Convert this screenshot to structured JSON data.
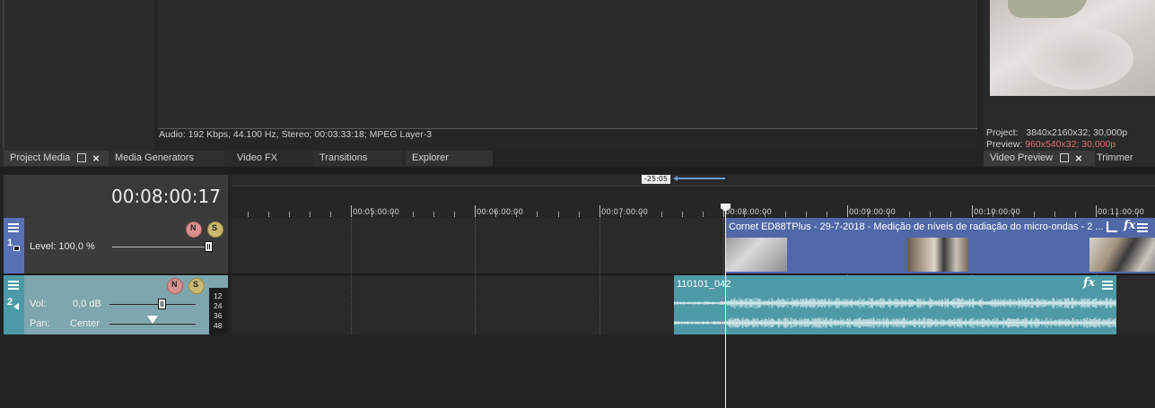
{
  "media_panel": {
    "info_text": "Audio: 192 Kbps, 44.100 Hz, Stereo; 00:03:33:18; MPEG Layer-3"
  },
  "left_tabs": [
    {
      "label": "Project Media"
    },
    {
      "label": "Media Generators"
    },
    {
      "label": "Video FX"
    },
    {
      "label": "Transitions"
    },
    {
      "label": "Explorer"
    }
  ],
  "preview": {
    "project_label": "Project:",
    "project_value": "3840x2160x32; 30,000p",
    "preview_label": "Preview:",
    "preview_value": "960x540x32; 30,000p",
    "preview_value_color": "#e07070"
  },
  "right_tabs": [
    {
      "label": "Video Preview"
    },
    {
      "label": "Trimmer"
    }
  ],
  "timeline": {
    "timecode": "00:08:00:17",
    "marker_label": "-25:05",
    "ruler_labels": [
      "00:05:00:00",
      "00:06:00:00",
      "00:07:00:00",
      "00:08:00:00",
      "00:09:00:00",
      "00:10:00:00",
      "00:11:00:00"
    ]
  },
  "tracks": {
    "video": {
      "number": "1",
      "level_label": "Level: 100,0 %",
      "level_value": 1.0,
      "clip_title": "Cornet ED88TPlus - 29-7-2018 - Medição de níveis de radiação do micro-ondas - 2 ...",
      "clip_color": "#5068a8"
    },
    "audio": {
      "number": "2",
      "vol_label": "Vol:",
      "vol_value": "0,0 dB",
      "pan_label": "Pan:",
      "pan_value": "Center",
      "meter_labels": [
        "12",
        "24",
        "36",
        "48"
      ],
      "clip_title": "110101_042",
      "clip_color": "#4e9aa6"
    }
  },
  "icons": {
    "mute": "mute-icon",
    "solo": "solo-icon",
    "fx": "fx-icon",
    "crop": "crop-icon",
    "menu": "menu-icon"
  }
}
